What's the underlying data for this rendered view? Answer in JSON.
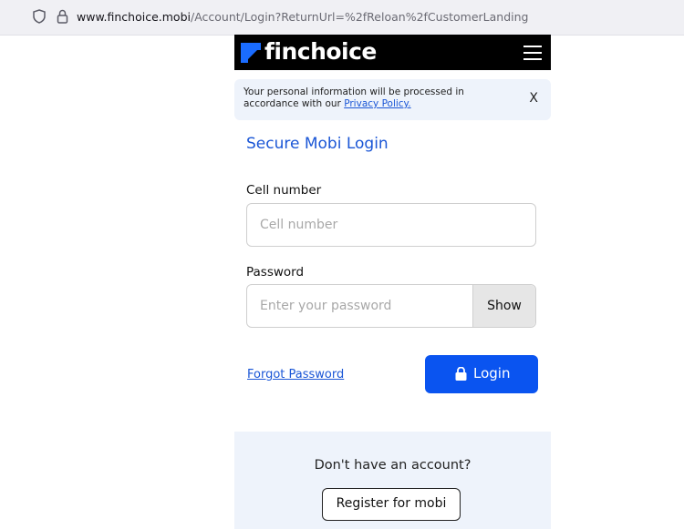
{
  "browser": {
    "url_host": "www.finchoice.mobi",
    "url_path": "/Account/Login?ReturnUrl=%2fReloan%2fCustomerLanding"
  },
  "header": {
    "brand": "finchoice"
  },
  "notice": {
    "text_prefix": "Your personal information will be processed in accordance with our",
    "link_label": "Privacy Policy.",
    "close_label": "X"
  },
  "login": {
    "title": "Secure Mobi Login",
    "cell_label": "Cell number",
    "cell_placeholder": "Cell number",
    "password_label": "Password",
    "password_placeholder": "Enter your password",
    "show_label": "Show",
    "forgot_label": "Forgot Password",
    "login_label": "Login"
  },
  "register": {
    "question": "Don't have an account?",
    "button_label": "Register for mobi"
  },
  "colors": {
    "brand_blue": "#0a54f0",
    "link_blue": "#1a56d6",
    "notice_bg": "#eef3fb",
    "header_bg": "#000000"
  },
  "icons": [
    "shield-icon",
    "lock-icon",
    "menu-icon",
    "padlock-icon"
  ]
}
